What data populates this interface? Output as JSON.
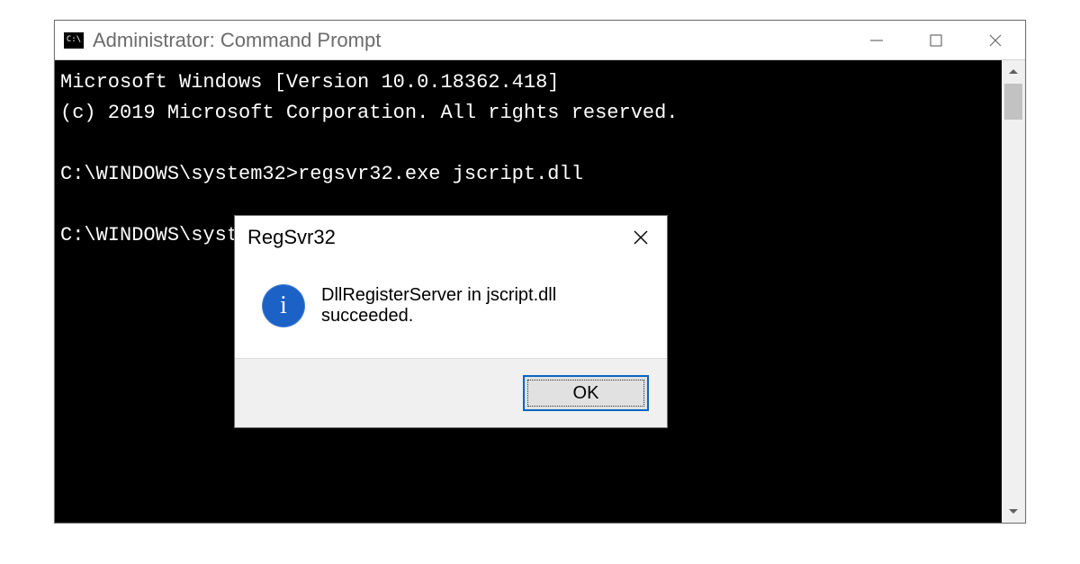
{
  "cmd": {
    "title": "Administrator: Command Prompt",
    "lines": {
      "l1": "Microsoft Windows [Version 10.0.18362.418]",
      "l2": "(c) 2019 Microsoft Corporation. All rights reserved.",
      "l3": "",
      "l4": "C:\\WINDOWS\\system32>regsvr32.exe jscript.dll",
      "l5": "",
      "l6": "C:\\WINDOWS\\syst"
    }
  },
  "dialog": {
    "title": "RegSvr32",
    "message": "DllRegisterServer in jscript.dll succeeded.",
    "ok_label": "OK"
  },
  "icons": {
    "cmd_glyph": "C:\\"
  }
}
